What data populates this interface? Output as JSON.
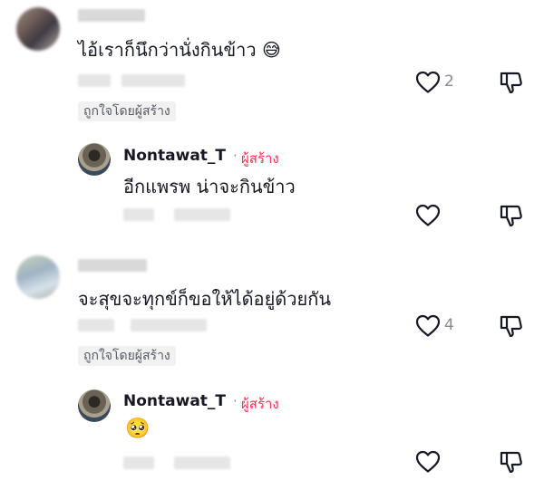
{
  "comments": [
    {
      "text": "ไอ้เราก็นึกว่านั่งกินข้าว 😅",
      "like_count": "2",
      "liked_by_creator": "ถูกใจโดยผู้สร้าง",
      "reply": {
        "username": "Nontawat_T",
        "separator": "·",
        "creator_label": "ผู้สร้าง",
        "text": "อีกแพรพ น่าจะกินข้าว"
      }
    },
    {
      "text": "จะสุขจะทุกข์ก็ขอให้ได้อยู่ด้วยกัน",
      "like_count": "4",
      "liked_by_creator": "ถูกใจโดยผู้สร้าง",
      "reply": {
        "username": "Nontawat_T",
        "separator": "·",
        "creator_label": "ผู้สร้าง",
        "text": "🥺"
      }
    }
  ]
}
